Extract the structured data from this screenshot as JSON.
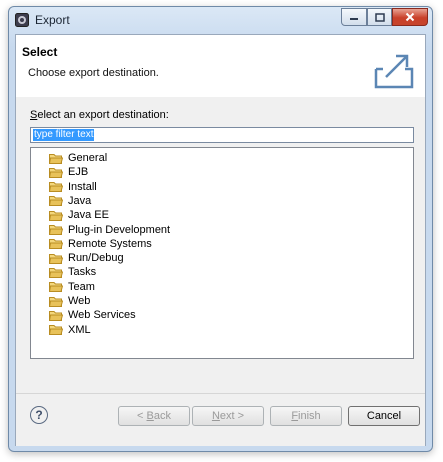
{
  "window": {
    "title": "Export",
    "controls": {
      "minimize": "minimize-icon",
      "maximize": "maximize-icon",
      "close": "close-icon"
    }
  },
  "banner": {
    "title": "Select",
    "description": "Choose export destination.",
    "icon": "export-icon"
  },
  "destination": {
    "label": "Select an export destination:",
    "filter_value": "type filter text"
  },
  "tree": {
    "items": [
      {
        "label": "General",
        "icon": "folder-icon"
      },
      {
        "label": "EJB",
        "icon": "folder-icon"
      },
      {
        "label": "Install",
        "icon": "folder-icon"
      },
      {
        "label": "Java",
        "icon": "folder-icon"
      },
      {
        "label": "Java EE",
        "icon": "folder-icon"
      },
      {
        "label": "Plug-in Development",
        "icon": "folder-icon"
      },
      {
        "label": "Remote Systems",
        "icon": "folder-icon"
      },
      {
        "label": "Run/Debug",
        "icon": "folder-icon"
      },
      {
        "label": "Tasks",
        "icon": "folder-icon"
      },
      {
        "label": "Team",
        "icon": "folder-icon"
      },
      {
        "label": "Web",
        "icon": "folder-icon"
      },
      {
        "label": "Web Services",
        "icon": "folder-icon"
      },
      {
        "label": "XML",
        "icon": "folder-icon"
      }
    ]
  },
  "footer": {
    "help": "?",
    "back": "< Back",
    "next": "Next >",
    "finish": "Finish",
    "cancel": "Cancel"
  },
  "colors": {
    "selection": "#3399ff",
    "folder": "#e8c25a",
    "close_button": "#c9402a"
  }
}
